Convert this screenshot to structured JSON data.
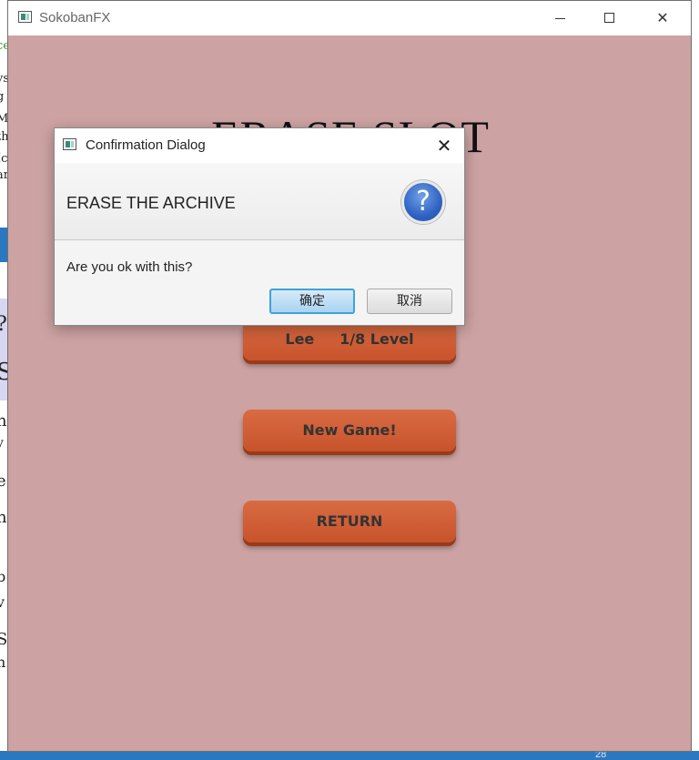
{
  "window": {
    "title": "SokobanFX",
    "controls": {
      "minimize_icon": "minimize-icon",
      "maximize_icon": "maximize-icon",
      "close_icon": "close-icon"
    }
  },
  "scene": {
    "heading": "ERASE SLOT",
    "buttons": {
      "slot_label": "Lee     1/8 Level",
      "new_game_label": "New Game!",
      "return_label": "RETURN"
    },
    "colors": {
      "background": "#cda2a2",
      "button": "#d25f36"
    }
  },
  "dialog": {
    "title": "Confirmation Dialog",
    "close_glyph": "✕",
    "header": "ERASE THE ARCHIVE",
    "icon": "question-icon",
    "icon_glyph": "?",
    "content": "Are you ok with this?",
    "ok_label": "确定",
    "cancel_label": "取消"
  },
  "background_window": {
    "glyphs": [
      "ce",
      "ys",
      "g",
      "M",
      "th",
      "Ic",
      "ar",
      "?",
      "S",
      "nc",
      "y",
      "e",
      "ne",
      "b",
      "v",
      "S",
      "n"
    ]
  },
  "taskbar": {
    "number": "28"
  }
}
